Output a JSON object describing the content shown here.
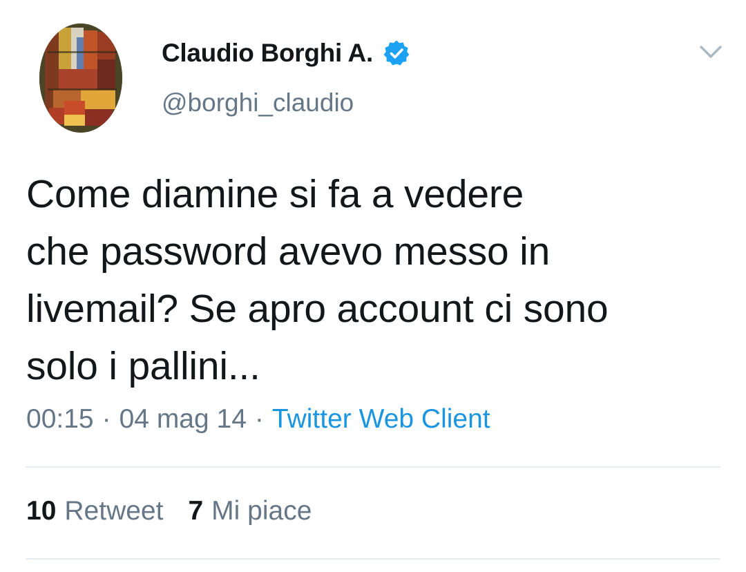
{
  "tweet": {
    "author": {
      "display_name": "Claudio Borghi A.",
      "handle": "@borghi_claudio",
      "verified": true
    },
    "text": "Come diamine si fa a vedere\nche password avevo messo in\nlivemail? Se apro account ci sono\nsolo i pallini...",
    "time": "00:15",
    "date": "04 mag 14",
    "separator": "·",
    "source": "Twitter Web Client",
    "stats": {
      "retweets_count": "10",
      "retweets_label": "Retweet",
      "likes_count": "7",
      "likes_label": "Mi piace"
    }
  },
  "icons": {
    "verified": "verified-badge-icon",
    "caret": "chevron-down-icon"
  },
  "colors": {
    "text_primary": "#14171a",
    "text_secondary": "#657786",
    "link_blue": "#1b95e0",
    "verified_blue": "#1da1f2",
    "divider": "#e6ecf0"
  }
}
